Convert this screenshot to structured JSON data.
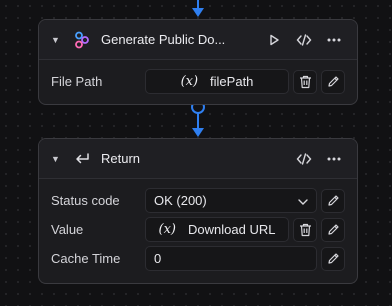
{
  "nodes": {
    "generate": {
      "title": "Generate Public Do...",
      "fields": {
        "file_path_label": "File Path",
        "file_path_var_symbol": "(x)",
        "file_path_value": "filePath"
      }
    },
    "return": {
      "title": "Return",
      "fields": {
        "status_code_label": "Status code",
        "status_code_value": "OK (200)",
        "value_label": "Value",
        "value_var_symbol": "(x)",
        "value_value": "Download URL",
        "cache_time_label": "Cache Time",
        "cache_time_value": "0"
      }
    }
  },
  "colors": {
    "connector": "#2f7ff0",
    "node_bg": "#1c1c1f",
    "canvas_bg": "#111113"
  },
  "icons": {
    "collapse": "chevron-down-icon",
    "generate_node": "link-nodes-icon",
    "return_node": "return-arrow-icon",
    "run": "play-icon",
    "code": "code-icon",
    "more": "more-horizontal-icon",
    "delete": "trash-icon",
    "edit": "pencil-icon"
  }
}
